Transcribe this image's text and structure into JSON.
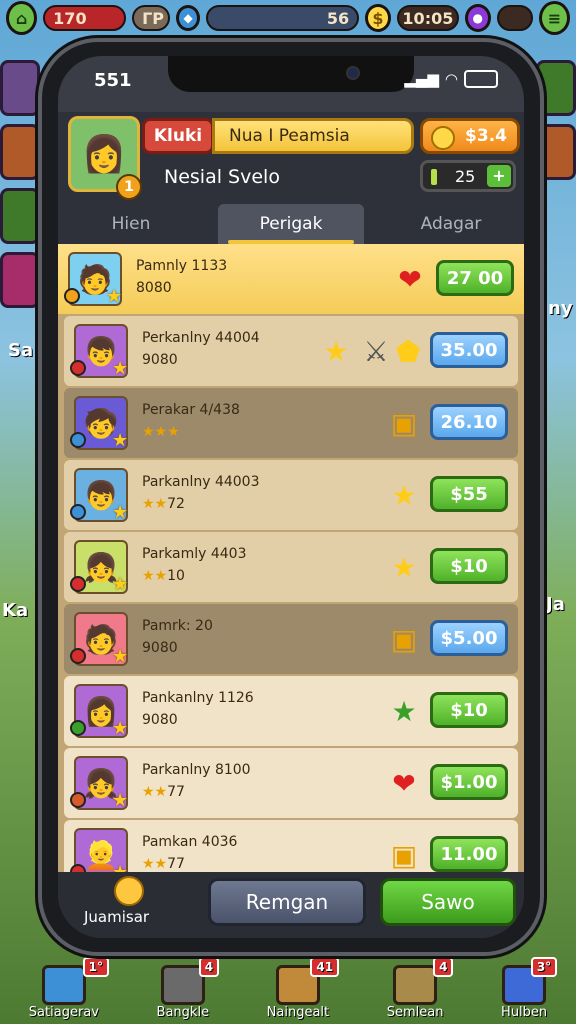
{
  "hud": {
    "left_value": "170",
    "left_tag": "ГР",
    "mid_value": "56",
    "time_display": "10:05"
  },
  "background": {
    "left_label": "Sa",
    "left_label2": "Ka",
    "right_label": "ny",
    "right_label2": "Ja"
  },
  "bottom_nav": [
    {
      "label": "Satiagerav",
      "badge": "1°"
    },
    {
      "label": "Bangkle",
      "badge": "4"
    },
    {
      "label": "Naingealt",
      "badge": "41"
    },
    {
      "label": "Semlean",
      "badge": "4"
    },
    {
      "label": "Hulben",
      "badge": "3°"
    }
  ],
  "status": {
    "time": "551",
    "battery": "▭"
  },
  "header": {
    "name_tag": "Kluki",
    "title": "Nua I Peamsia",
    "coins": "$3.4",
    "level": "1",
    "subtitle": "Nesial Svelo",
    "counter": "25",
    "counter_plus": "+"
  },
  "tabs": [
    {
      "label": "Hien",
      "active": false
    },
    {
      "label": "Perigak",
      "active": true
    },
    {
      "label": "Adagar",
      "active": false
    }
  ],
  "rows": [
    {
      "title": "Pamnly 1133",
      "sub": "8080",
      "stars": "",
      "price": "27 00",
      "price_style": "green",
      "item": "heart"
    },
    {
      "title": "Perkanlny 44004",
      "sub": "9080",
      "stars": "",
      "price": "35.00",
      "price_style": "blue",
      "item": "swords"
    },
    {
      "title": "Perakar 4/438",
      "sub": "",
      "stars": "★★★",
      "price": "26.10",
      "price_style": "blue",
      "item": "box"
    },
    {
      "title": "Parkanlny 44003",
      "sub": "72",
      "stars": "★★",
      "price": "$55",
      "price_style": "green",
      "item": "star"
    },
    {
      "title": "Parkamly 4403",
      "sub": "10",
      "stars": "★★",
      "price": "$10",
      "price_style": "green",
      "item": "star"
    },
    {
      "title": "Pamrk: 20",
      "sub": "9080",
      "stars": "",
      "price": "$5.00",
      "price_style": "blue",
      "item": "box"
    },
    {
      "title": "Pankanlny 1126",
      "sub": "9080",
      "stars": "",
      "price": "$10",
      "price_style": "green",
      "item": "green-star"
    },
    {
      "title": "Parkanlny 8100",
      "sub": "77",
      "stars": "★★",
      "price": "$1.00",
      "price_style": "green",
      "item": "heart"
    },
    {
      "title": "Pamkan 4036",
      "sub": "77",
      "stars": "★★",
      "price": "11.00",
      "price_style": "green",
      "item": "box"
    }
  ],
  "footer": {
    "left_label": "Juamisar",
    "btn_secondary": "Remgan",
    "btn_primary": "Sawo"
  },
  "colors": {
    "gold": "#f4c43a",
    "green_btn": "#4fb22a",
    "blue_btn": "#5aa8ec",
    "red_tag": "#d7493b"
  }
}
